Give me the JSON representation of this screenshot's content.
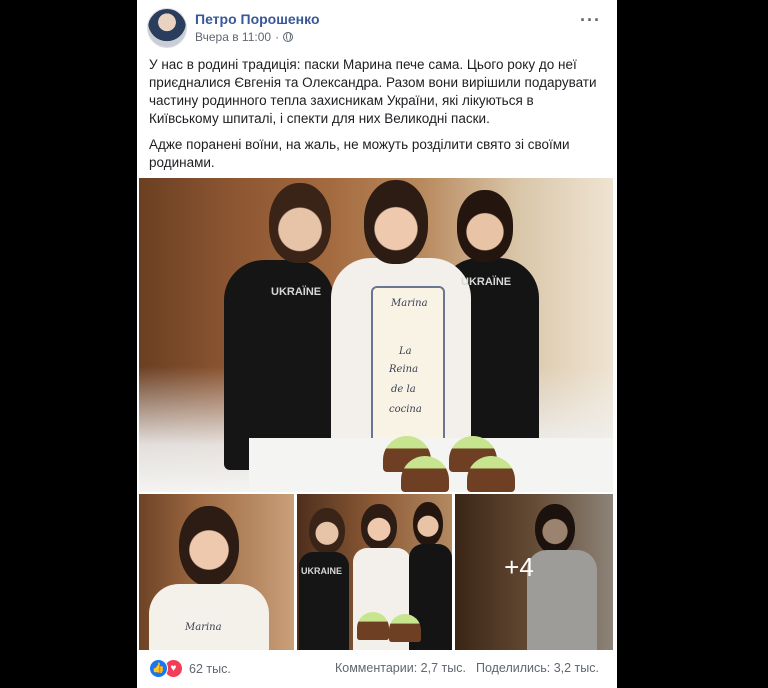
{
  "post": {
    "author": "Петро Порошенко",
    "timestamp": "Вчера в 11:00",
    "privacy_icon": "globe-icon",
    "more_icon": "ellipsis-icon",
    "text": {
      "paragraph_1": "У нас в родині традиція: паски Марина пече сама. Цього року до неї приєдналися Євгенія та Олександра. Разом вони вирішили подарувати частину родинного тепла захисникам України, які лікуються в Київському шпиталі, і спекти для них Великодні паски.",
      "paragraph_2": "Адже поранені воїни, на жаль, не можуть розділити свято зі своїми родинами."
    }
  },
  "photos": {
    "main": {
      "shirt_text_left": "UKRAÏNE",
      "shirt_text_right": "UKRAÏNE",
      "apron_lines": [
        "Marina",
        "La",
        "Reina",
        "de la",
        "cocina"
      ]
    },
    "thumb_apron_text": "Marina",
    "thumb_shirt_text": "UKRAINE",
    "more_count": "+4"
  },
  "footer": {
    "reaction_count": "62 тыс.",
    "comments": "Комментарии: 2,7 тыс.",
    "shares": "Поделились: 3,2 тыс."
  },
  "colors": {
    "author_link": "#385898",
    "like": "#1877f2",
    "love": "#f33e58",
    "secondary_text": "#606770"
  }
}
